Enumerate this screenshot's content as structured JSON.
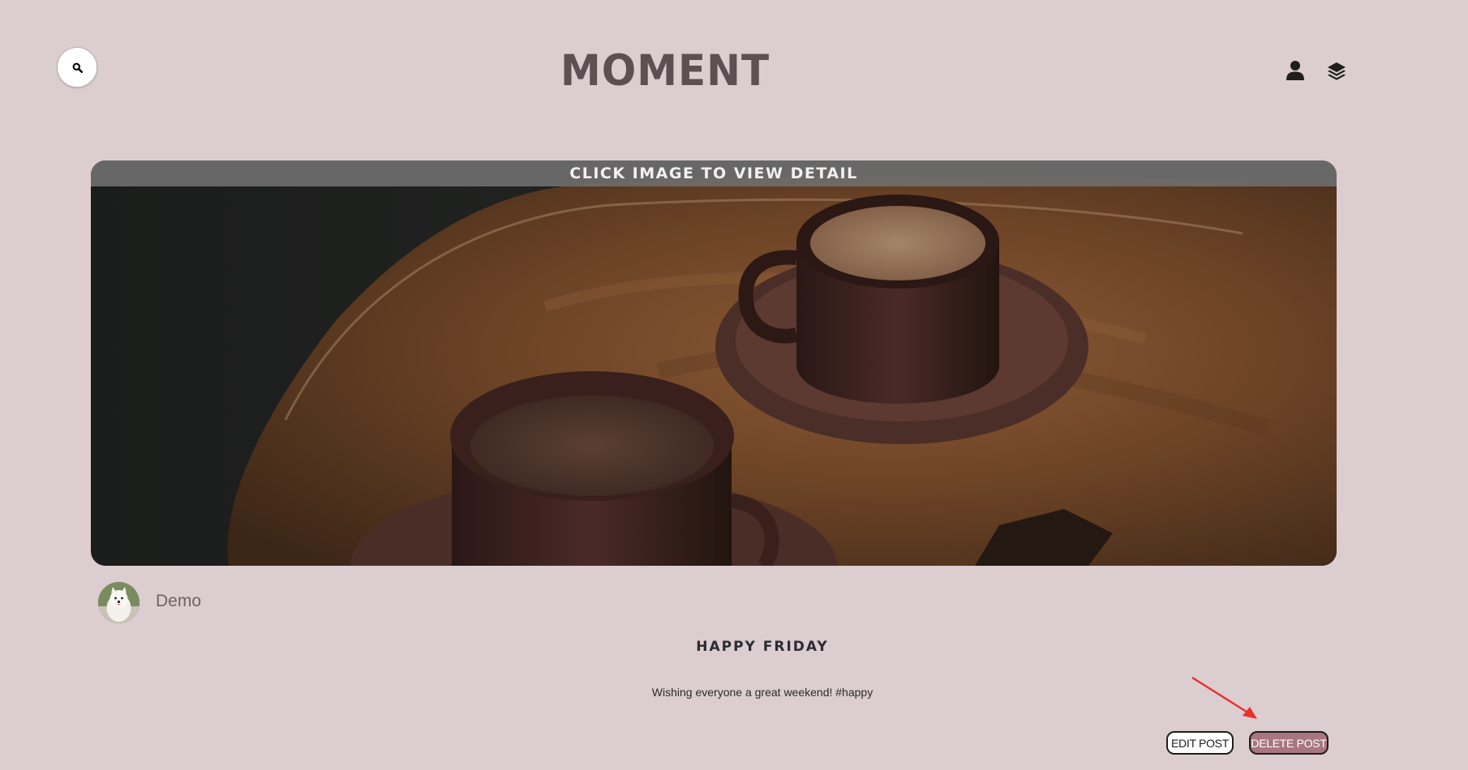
{
  "header": {
    "logo": "MOMENT",
    "search_icon": "search-icon",
    "user_icon": "user-icon",
    "layers_icon": "layers-icon"
  },
  "hero": {
    "overlay_text": "CLICK IMAGE TO VIEW DETAIL",
    "image_subject": "two-coffee-cups-on-wooden-table"
  },
  "author": {
    "name": "Demo",
    "avatar": "white-dog-avatar"
  },
  "post": {
    "title": "HAPPY FRIDAY",
    "body": "Wishing everyone a great weekend! #happy"
  },
  "actions": {
    "edit_label": "EDIT POST",
    "delete_label": "DELETE POST"
  },
  "colors": {
    "background": "#dbcdd0",
    "logo": "#5d4f53",
    "delete_button": "#a9767f",
    "annotation_arrow": "#e8312a"
  }
}
